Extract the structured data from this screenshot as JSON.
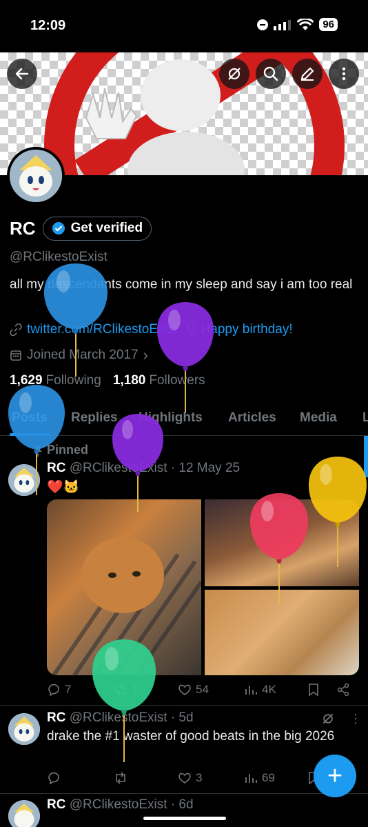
{
  "status": {
    "time": "12:09",
    "battery": "96"
  },
  "profile": {
    "name": "RC",
    "verify_label": "Get verified",
    "handle": "@RClikestoExist",
    "bio": "all my descendants come in my sleep and say i am too real",
    "link": "twitter.com/RClikestoExist",
    "birthday": "Happy birthday!",
    "joined": "Joined March 2017",
    "following_count": "1,629",
    "following_label": "Following",
    "followers_count": "1,180",
    "followers_label": "Followers"
  },
  "tabs": [
    "Posts",
    "Replies",
    "Highlights",
    "Articles",
    "Media",
    "L"
  ],
  "posts": [
    {
      "pinned": "Pinned",
      "name": "RC",
      "handle_time": "@RClikestoExist · 12 May 25",
      "text": "❤️🐱",
      "replies": "7",
      "reposts": "1",
      "likes": "54",
      "views": "4K"
    },
    {
      "name": "RC",
      "handle_time": "@RClikestoExist · 5d",
      "text": "drake the #1 waster of good beats in the big 2026",
      "replies": "",
      "reposts": "",
      "likes": "3",
      "views": "69"
    },
    {
      "name": "RC",
      "handle_time": "@RClikestoExist · 6d"
    }
  ],
  "colors": {
    "accent": "#1d9bf0",
    "balloon_blue": "#2a8fe0",
    "balloon_purple": "#8a2be2",
    "balloon_yellow": "#f4c20d",
    "balloon_red": "#ee3b5f",
    "balloon_green": "#2fd08e"
  },
  "icons": [
    "back-arrow-icon",
    "grok-icon",
    "search-icon",
    "edit-icon",
    "more-icon",
    "verified-badge-icon",
    "link-icon",
    "balloon-icon",
    "calendar-icon",
    "reply-icon",
    "repost-icon",
    "like-icon",
    "views-icon",
    "bookmark-icon",
    "share-icon",
    "compose-icon"
  ]
}
